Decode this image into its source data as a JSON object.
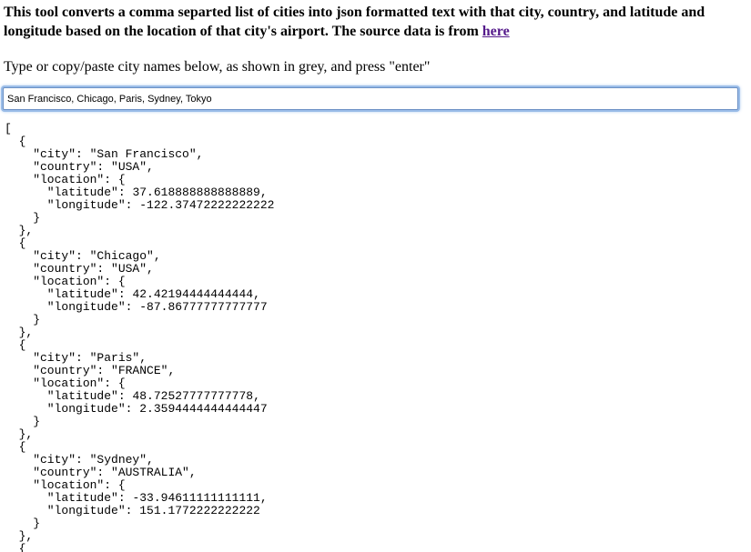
{
  "intro": {
    "text": "This tool converts a comma separted list of cities into json formatted text with that city, country, and latitude and longitude based on the location of that city's airport. The source data is from ",
    "link_label": "here"
  },
  "instruction": "Type or copy/paste city names below, as shown in grey, and press \"enter\"",
  "input": {
    "value": "San Francisco, Chicago, Paris, Sydney, Tokyo"
  },
  "output": {
    "results": [
      {
        "city": "San Francisco",
        "country": "USA",
        "latitude": "37.618888888888889",
        "longitude": "-122.37472222222222"
      },
      {
        "city": "Chicago",
        "country": "USA",
        "latitude": "42.42194444444444",
        "longitude": "-87.86777777777777"
      },
      {
        "city": "Paris",
        "country": "FRANCE",
        "latitude": "48.72527777777778",
        "longitude": "2.3594444444444447"
      },
      {
        "city": "Sydney",
        "country": "AUSTRALIA",
        "latitude": "-33.94611111111111",
        "longitude": "151.1772222222222"
      }
    ]
  }
}
